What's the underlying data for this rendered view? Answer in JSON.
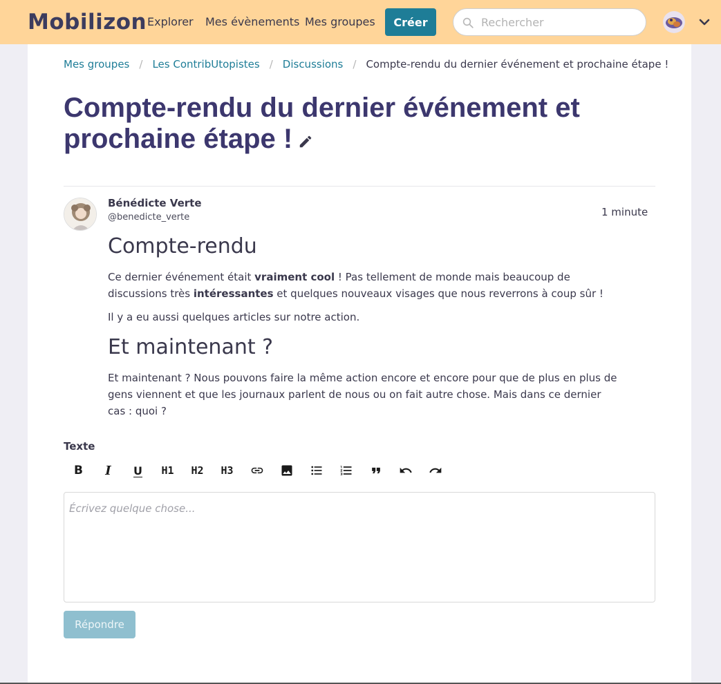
{
  "navbar": {
    "logo": "Mobilizon",
    "links": [
      "Explorer",
      "Mes évènements",
      "Mes groupes"
    ],
    "create_label": "Créer",
    "search_placeholder": "Rechercher",
    "bg_color": "#ffd599",
    "accent_color": "#1e7d97"
  },
  "breadcrumb": {
    "items": [
      "Mes groupes",
      "Les ContribUtopistes",
      "Discussions"
    ],
    "current": "Compte-rendu du dernier événement et prochaine étape !"
  },
  "discussion": {
    "title": "Compte-rendu du dernier événement et prochaine étape !"
  },
  "comment": {
    "author_name": "Bénédicte Verte",
    "author_handle": "@benedicte_verte",
    "timestamp": "1 minute",
    "heading1": "Compte-rendu",
    "p1_a": "Ce dernier événement était ",
    "p1_bold1": "vraiment cool",
    "p1_b": " ! Pas tellement de monde mais beaucoup de discussions très ",
    "p1_bold2": "intéressantes",
    "p1_c": " et quelques nouveaux visages que nous reverrons à coup sûr !",
    "p2": "Il y a eu aussi quelques articles sur notre action.",
    "heading2": "Et maintenant ?",
    "p3": "Et maintenant ? Nous pouvons faire la même action encore et encore pour que de plus en plus de gens viennent et que les journaux parlent de nous ou on fait autre chose. Mais dans ce dernier cas : quoi ?"
  },
  "editor": {
    "label": "Texte",
    "toolbar": {
      "bold": "B",
      "italic": "I",
      "underline": "U",
      "h1": "H1",
      "h2": "H2",
      "h3": "H3"
    },
    "placeholder": "Écrivez quelque chose...",
    "reply_label": "Répondre"
  }
}
